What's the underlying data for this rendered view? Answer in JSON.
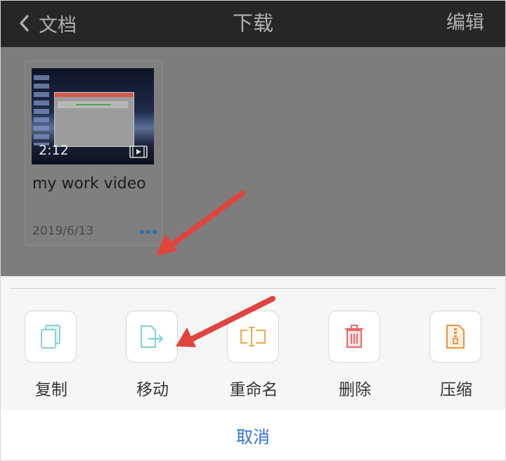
{
  "navbar": {
    "back_label": "文档",
    "title": "下载",
    "edit_label": "编辑"
  },
  "file": {
    "duration": "2:12",
    "name": "my work video",
    "date": "2019/6/13"
  },
  "actions": [
    {
      "label": "复制",
      "icon": "copy-icon",
      "color": "#8ad1d6"
    },
    {
      "label": "移动",
      "icon": "move-icon",
      "color": "#7fd0d8"
    },
    {
      "label": "重命名",
      "icon": "rename-icon",
      "color": "#f0a94a"
    },
    {
      "label": "删除",
      "icon": "trash-icon",
      "color": "#e86a6a"
    },
    {
      "label": "压缩",
      "icon": "compress-icon",
      "color": "#e9953e"
    }
  ],
  "cancel_label": "取消",
  "colors": {
    "navbar_bg": "#262626",
    "overlay_bg": "#7d7d7d",
    "accent_blue": "#2e6fd6",
    "annotation_arrow": "#e0453d"
  }
}
